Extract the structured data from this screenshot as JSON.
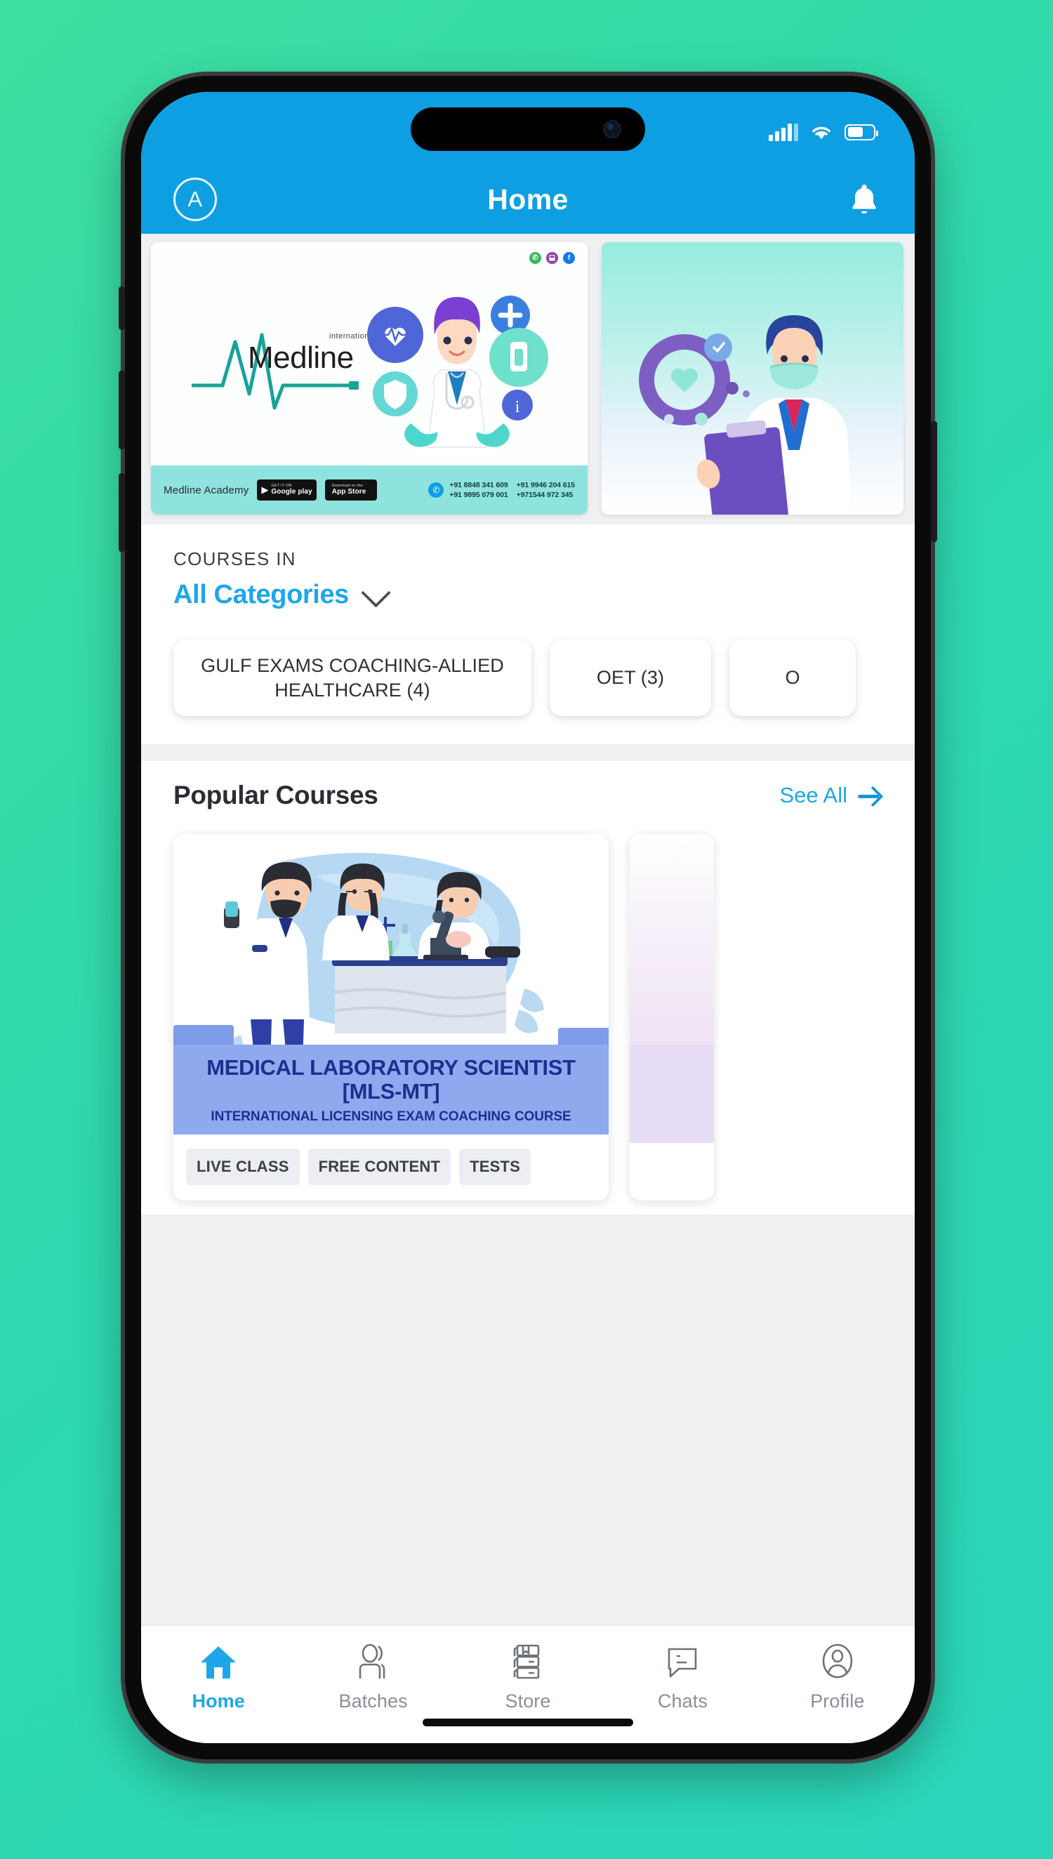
{
  "status_bar": {
    "signal_icon": "signal-bars-icon",
    "wifi_icon": "wifi-icon",
    "battery_icon": "battery-icon",
    "battery_level": "62%"
  },
  "app_bar": {
    "avatar_initial": "A",
    "title": "Home",
    "bell_icon": "notification-bell-icon"
  },
  "banners": [
    {
      "brand_name": "Medline",
      "brand_superscript": "international",
      "footer_label": "Medline Academy",
      "store_badges": [
        {
          "small": "GET IT ON",
          "big": "Google play"
        },
        {
          "small": "Download on the",
          "big": "App Store"
        }
      ],
      "phones": [
        "+91 8848 341 609",
        "+91 9895 079 001",
        "+91 9946 204 615",
        "+971544 972 345"
      ],
      "socials": [
        "whatsapp",
        "instagram",
        "facebook"
      ],
      "accent": "#17a398",
      "footer_bg": "#8fe3de"
    },
    {
      "alt": "Doctor with mask holding clipboard",
      "accent": "#96ecdf"
    }
  ],
  "categories_section": {
    "label": "COURSES IN",
    "selected": "All Categories",
    "chevron_icon": "chevron-down-icon",
    "chips": [
      "GULF EXAMS COACHING-ALLIED HEALTHCARE (4)",
      "OET (3)",
      "O"
    ]
  },
  "popular_section": {
    "title": "Popular Courses",
    "see_all_label": "See All",
    "see_all_icon": "arrow-right-icon",
    "courses": [
      {
        "title_line1": "MEDICAL LABORATORY SCIENTIST",
        "title_line2": "[MLS-MT]",
        "subtitle": "INTERNATIONAL LICENSING EXAM COACHING COURSE",
        "tags": [
          "LIVE CLASS",
          "FREE CONTENT",
          "TESTS"
        ],
        "banner_bg": "#8fa9ee",
        "title_color": "#1c2f8f"
      },
      {
        "title_line1": "",
        "tags": []
      }
    ]
  },
  "bottom_nav": {
    "items": [
      {
        "label": "Home",
        "icon": "home-icon",
        "active": true
      },
      {
        "label": "Batches",
        "icon": "people-icon",
        "active": false
      },
      {
        "label": "Store",
        "icon": "books-icon",
        "active": false
      },
      {
        "label": "Chats",
        "icon": "chat-icon",
        "active": false
      },
      {
        "label": "Profile",
        "icon": "person-icon",
        "active": false
      }
    ],
    "active_color": "#1ea7e8",
    "inactive_color": "#8a9096"
  },
  "theme": {
    "brand_blue": "#0e9fe3",
    "link_blue": "#1ea7e8",
    "page_bg": "#eef0f2",
    "desktop_bg": "#34d9a6"
  }
}
